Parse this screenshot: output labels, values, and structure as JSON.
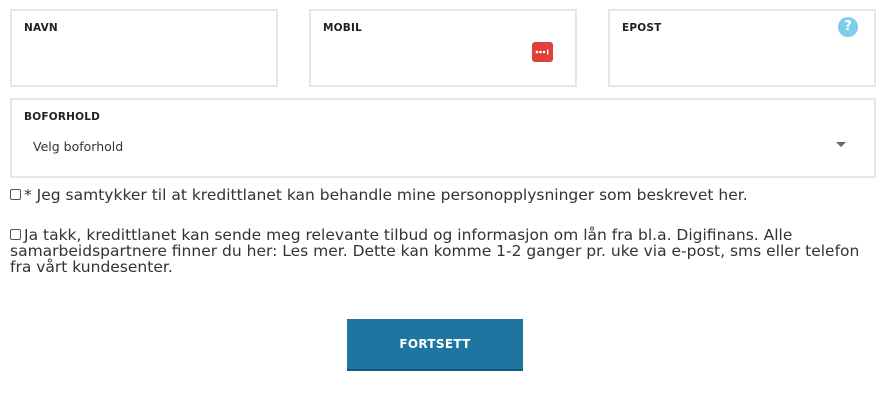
{
  "form": {
    "navn": {
      "label": "NAVN",
      "value": ""
    },
    "mobil": {
      "label": "MOBIL",
      "value": "",
      "icon": "password-manager-icon",
      "icon_color": "#e0403a"
    },
    "epost": {
      "label": "EPOST",
      "value": "",
      "help_icon": "?",
      "help_color": "#7fcdea"
    },
    "boforhold": {
      "label": "BOFORHOLD",
      "selected": "Velg boforhold"
    }
  },
  "consents": [
    {
      "text": "* Jeg samtykker til at kredittlanet kan behandle mine personopplysninger som beskrevet her.",
      "checked": false
    },
    {
      "text": "Ja takk, kredittlanet kan sende meg relevante tilbud og informasjon om lån fra bl.a. Digifinans. Alle samarbeidspartnere finner du her: Les mer. Dette kan komme 1-2 ganger pr. uke via e-post, sms eller telefon fra vårt kundesenter.",
      "checked": false
    }
  ],
  "submit": {
    "label": "FORTSETT",
    "color": "#1e75a0"
  }
}
